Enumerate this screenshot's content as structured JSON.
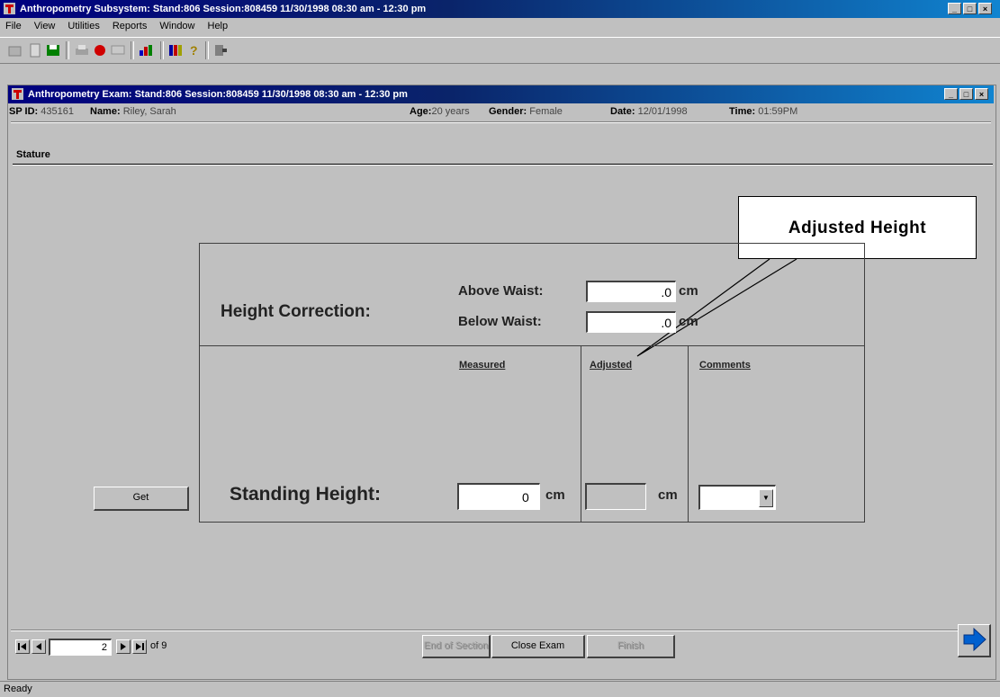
{
  "app": {
    "title": "Anthropometry Subsystem: Stand:806 Session:808459 11/30/1998 08:30 am - 12:30 pm",
    "menu": [
      "File",
      "View",
      "Utilities",
      "Reports",
      "Window",
      "Help"
    ]
  },
  "exam_window": {
    "title": "Anthropometry Exam: Stand:806 Session:808459 11/30/1998 08:30 am - 12:30 pm"
  },
  "participant": {
    "sp_id_label": "SP ID:",
    "sp_id": "435161",
    "name_label": "Name:",
    "name": "Riley, Sarah",
    "age_label": "Age:",
    "age": "20 years",
    "gender_label": "Gender:",
    "gender": "Female",
    "date_label": "Date:",
    "date": "12/01/1998",
    "time_label": "Time:",
    "time": "01:59PM"
  },
  "section": "Stature",
  "height_correction": {
    "label": "Height Correction:",
    "above_label": "Above Waist:",
    "above_value": ".0",
    "below_label": "Below Waist:",
    "below_value": ".0",
    "unit": "cm"
  },
  "columns": {
    "measured": "Measured",
    "adjusted": "Adjusted",
    "comments": "Comments"
  },
  "standing_height": {
    "label": "Standing Height:",
    "measured_value": "0",
    "adjusted_value": "",
    "unit": "cm",
    "comment_value": ""
  },
  "buttons": {
    "get": "Get",
    "end_of_section": "End of Section",
    "close_exam": "Close Exam",
    "finish": "Finish"
  },
  "nav": {
    "page": "2",
    "of_label": "of 9"
  },
  "callout": "Adjusted Height",
  "status": "Ready"
}
